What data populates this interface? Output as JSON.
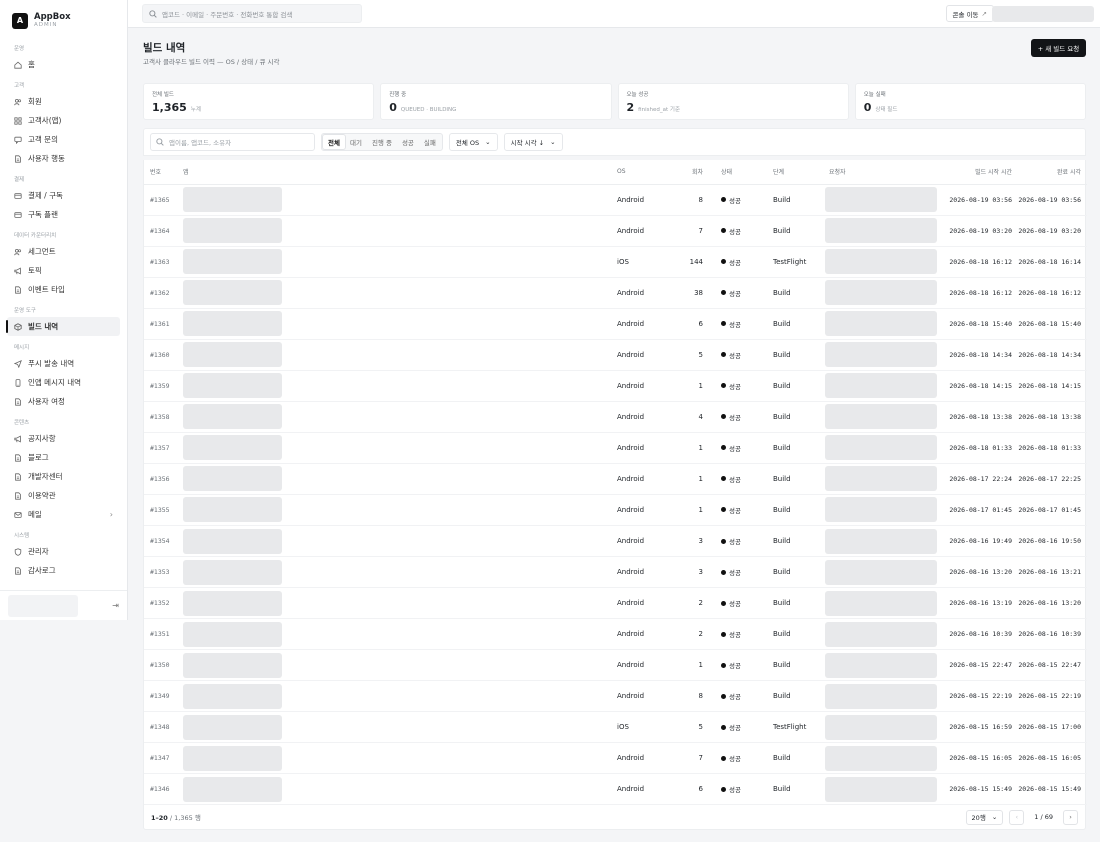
{
  "brand": {
    "name": "AppBox",
    "sub": "ADMIN",
    "logo": "A"
  },
  "sidebar": {
    "sections": [
      {
        "title": "운영",
        "items": [
          {
            "label": "홈",
            "icon": "home-icon"
          }
        ]
      },
      {
        "title": "고객",
        "items": [
          {
            "label": "회원",
            "icon": "users-icon"
          },
          {
            "label": "고객사(앱)",
            "icon": "grid-icon"
          },
          {
            "label": "고객 문의",
            "icon": "chat-icon"
          },
          {
            "label": "사용자 행동",
            "icon": "document-icon"
          }
        ]
      },
      {
        "title": "결제",
        "items": [
          {
            "label": "결제 / 구독",
            "icon": "card-icon"
          },
          {
            "label": "구독 플랜",
            "icon": "card-icon"
          }
        ]
      },
      {
        "title": "데이터 카운터리치",
        "items": [
          {
            "label": "세그먼트",
            "icon": "users-icon"
          },
          {
            "label": "토픽",
            "icon": "megaphone-icon"
          },
          {
            "label": "이벤트 타입",
            "icon": "document-icon"
          }
        ]
      },
      {
        "title": "운영 도구",
        "items": [
          {
            "label": "빌드 내역",
            "icon": "cube-icon",
            "active": true
          }
        ]
      },
      {
        "title": "메시지",
        "items": [
          {
            "label": "푸시 발송 내역",
            "icon": "send-icon"
          },
          {
            "label": "인앱 메시지 내역",
            "icon": "phone-icon"
          },
          {
            "label": "사용자 여정",
            "icon": "document-icon"
          }
        ]
      },
      {
        "title": "콘텐츠",
        "items": [
          {
            "label": "공지사항",
            "icon": "megaphone-icon"
          },
          {
            "label": "블로그",
            "icon": "document-icon"
          },
          {
            "label": "개발자센터",
            "icon": "document-icon"
          },
          {
            "label": "이용약관",
            "icon": "document-icon"
          },
          {
            "label": "메일",
            "icon": "mail-icon",
            "chevron": "›"
          }
        ]
      },
      {
        "title": "시스템",
        "items": [
          {
            "label": "관리자",
            "icon": "shield-icon"
          },
          {
            "label": "감사로그",
            "icon": "document-icon"
          }
        ]
      }
    ],
    "logout_glyph": "⇥"
  },
  "topbar": {
    "search_placeholder": "앱코드 · 이메일 · 주문번호 · 전화번호 통합 검색",
    "console_label": "콘솔 이동",
    "console_glyph": "↗"
  },
  "page": {
    "title": "빌드 내역",
    "subtitle": "고객사 클라우드 빌드 이력 — OS / 상태 / 큐 시각",
    "new_button": "+ 새 빌드 요청"
  },
  "stats": [
    {
      "label": "전체 빌드",
      "value": "1,365",
      "note": "누계"
    },
    {
      "label": "진행 중",
      "value": "0",
      "note": "QUEUED · BUILDING"
    },
    {
      "label": "오늘 성공",
      "value": "2",
      "note": "finished_at 기준"
    },
    {
      "label": "오늘 실패",
      "value": "0",
      "note": "상태 필드"
    }
  ],
  "filters": {
    "search_placeholder": "앱이름, 앱코드, 소유자",
    "segments": [
      "전체",
      "대기",
      "진행 중",
      "성공",
      "실패"
    ],
    "active_segment": 0,
    "os_select": "전체 OS",
    "sort_select": "시작 시각 ↓",
    "chevron": "⌄"
  },
  "table": {
    "columns": {
      "num": "번호",
      "app": "앱",
      "os": "OS",
      "round": "회차",
      "status": "상태",
      "stage": "단계",
      "requester": "요청자",
      "started": "빌드 시작 시간",
      "finished": "완료 시각"
    },
    "rows": [
      {
        "num": "#1365",
        "os": "Android",
        "round": "8",
        "status": "성공",
        "stage": "Build",
        "started": "2026-08-19 03:56",
        "finished": "2026-08-19 03:56"
      },
      {
        "num": "#1364",
        "os": "Android",
        "round": "7",
        "status": "성공",
        "stage": "Build",
        "started": "2026-08-19 03:20",
        "finished": "2026-08-19 03:20"
      },
      {
        "num": "#1363",
        "os": "iOS",
        "round": "144",
        "status": "성공",
        "stage": "TestFlight",
        "started": "2026-08-18 16:12",
        "finished": "2026-08-18 16:14"
      },
      {
        "num": "#1362",
        "os": "Android",
        "round": "38",
        "status": "성공",
        "stage": "Build",
        "started": "2026-08-18 16:12",
        "finished": "2026-08-18 16:12"
      },
      {
        "num": "#1361",
        "os": "Android",
        "round": "6",
        "status": "성공",
        "stage": "Build",
        "started": "2026-08-18 15:40",
        "finished": "2026-08-18 15:40"
      },
      {
        "num": "#1360",
        "os": "Android",
        "round": "5",
        "status": "성공",
        "stage": "Build",
        "started": "2026-08-18 14:34",
        "finished": "2026-08-18 14:34"
      },
      {
        "num": "#1359",
        "os": "Android",
        "round": "1",
        "status": "성공",
        "stage": "Build",
        "started": "2026-08-18 14:15",
        "finished": "2026-08-18 14:15"
      },
      {
        "num": "#1358",
        "os": "Android",
        "round": "4",
        "status": "성공",
        "stage": "Build",
        "started": "2026-08-18 13:38",
        "finished": "2026-08-18 13:38"
      },
      {
        "num": "#1357",
        "os": "Android",
        "round": "1",
        "status": "성공",
        "stage": "Build",
        "started": "2026-08-18 01:33",
        "finished": "2026-08-18 01:33"
      },
      {
        "num": "#1356",
        "os": "Android",
        "round": "1",
        "status": "성공",
        "stage": "Build",
        "started": "2026-08-17 22:24",
        "finished": "2026-08-17 22:25"
      },
      {
        "num": "#1355",
        "os": "Android",
        "round": "1",
        "status": "성공",
        "stage": "Build",
        "started": "2026-08-17 01:45",
        "finished": "2026-08-17 01:45"
      },
      {
        "num": "#1354",
        "os": "Android",
        "round": "3",
        "status": "성공",
        "stage": "Build",
        "started": "2026-08-16 19:49",
        "finished": "2026-08-16 19:50"
      },
      {
        "num": "#1353",
        "os": "Android",
        "round": "3",
        "status": "성공",
        "stage": "Build",
        "started": "2026-08-16 13:20",
        "finished": "2026-08-16 13:21"
      },
      {
        "num": "#1352",
        "os": "Android",
        "round": "2",
        "status": "성공",
        "stage": "Build",
        "started": "2026-08-16 13:19",
        "finished": "2026-08-16 13:20"
      },
      {
        "num": "#1351",
        "os": "Android",
        "round": "2",
        "status": "성공",
        "stage": "Build",
        "started": "2026-08-16 10:39",
        "finished": "2026-08-16 10:39"
      },
      {
        "num": "#1350",
        "os": "Android",
        "round": "1",
        "status": "성공",
        "stage": "Build",
        "started": "2026-08-15 22:47",
        "finished": "2026-08-15 22:47"
      },
      {
        "num": "#1349",
        "os": "Android",
        "round": "8",
        "status": "성공",
        "stage": "Build",
        "started": "2026-08-15 22:19",
        "finished": "2026-08-15 22:19"
      },
      {
        "num": "#1348",
        "os": "iOS",
        "round": "5",
        "status": "성공",
        "stage": "TestFlight",
        "started": "2026-08-15 16:59",
        "finished": "2026-08-15 17:00"
      },
      {
        "num": "#1347",
        "os": "Android",
        "round": "7",
        "status": "성공",
        "stage": "Build",
        "started": "2026-08-15 16:05",
        "finished": "2026-08-15 16:05"
      },
      {
        "num": "#1346",
        "os": "Android",
        "round": "6",
        "status": "성공",
        "stage": "Build",
        "started": "2026-08-15 15:49",
        "finished": "2026-08-15 15:49"
      }
    ]
  },
  "footer": {
    "range": "1–20",
    "total": "/ 1,365 행",
    "page_size": "20행",
    "page_info": "1 / 69",
    "prev": "‹",
    "next": "›"
  },
  "colors": {
    "accent": "#121417",
    "muted": "#6b7177",
    "skeleton": "#e8e9eb"
  }
}
